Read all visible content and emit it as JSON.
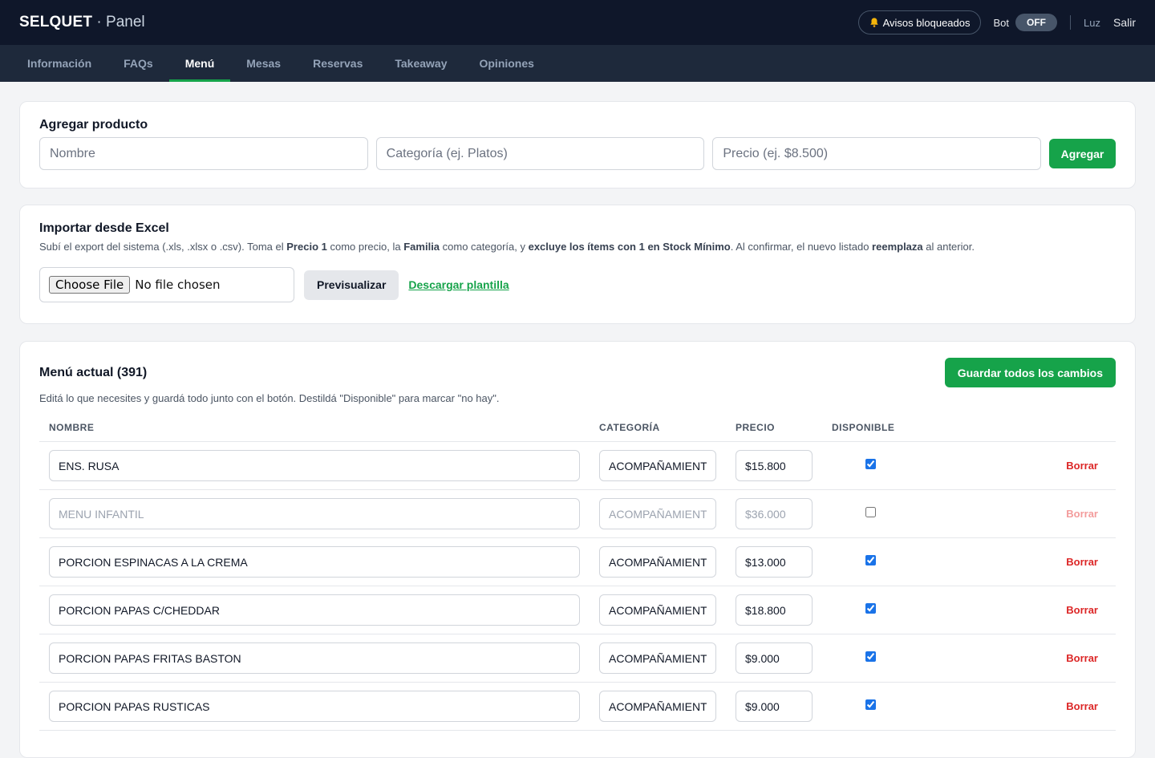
{
  "header": {
    "brand": "SELQUET",
    "separator": "·",
    "subtitle": "Panel",
    "alerts_label": "Avisos bloqueados",
    "bot_label": "Bot",
    "bot_state": "OFF",
    "user": "Luz",
    "logout": "Salir"
  },
  "tabs": [
    {
      "label": "Información",
      "active": false
    },
    {
      "label": "FAQs",
      "active": false
    },
    {
      "label": "Menú",
      "active": true
    },
    {
      "label": "Mesas",
      "active": false
    },
    {
      "label": "Reservas",
      "active": false
    },
    {
      "label": "Takeaway",
      "active": false
    },
    {
      "label": "Opiniones",
      "active": false
    }
  ],
  "add_product": {
    "title": "Agregar producto",
    "name_placeholder": "Nombre",
    "category_placeholder": "Categoría (ej. Platos)",
    "price_placeholder": "Precio (ej. $8.500)",
    "button": "Agregar"
  },
  "import": {
    "title": "Importar desde Excel",
    "desc_1": "Subí el export del sistema (.xls, .xlsx o .csv). Toma el ",
    "desc_b1": "Precio 1",
    "desc_2": " como precio, la ",
    "desc_b2": "Familia",
    "desc_3": " como categoría, y ",
    "desc_b3": "excluye los ítems con 1 en Stock Mínimo",
    "desc_4": ". Al confirmar, el nuevo listado ",
    "desc_b4": "reemplaza",
    "desc_5": " al anterior.",
    "file_button": "Choose File",
    "file_status": "No file chosen",
    "preview_button": "Previsualizar",
    "template_link": "Descargar plantilla"
  },
  "menu": {
    "title": "Menú actual (391)",
    "save_button": "Guardar todos los cambios",
    "desc": "Editá lo que necesites y guardá todo junto con el botón. Destildá \"Disponible\" para marcar \"no hay\".",
    "columns": {
      "name": "NOMBRE",
      "category": "CATEGORÍA",
      "price": "PRECIO",
      "available": "DISPONIBLE"
    },
    "delete_label": "Borrar",
    "rows": [
      {
        "name": "ENS. RUSA",
        "category": "ACOMPAÑAMIENTOS",
        "price": "$15.800",
        "available": true
      },
      {
        "name": "MENU INFANTIL",
        "category": "ACOMPAÑAMIENTOS",
        "price": "$36.000",
        "available": false
      },
      {
        "name": "PORCION ESPINACAS A LA CREMA",
        "category": "ACOMPAÑAMIENTOS",
        "price": "$13.000",
        "available": true
      },
      {
        "name": "PORCION PAPAS C/CHEDDAR",
        "category": "ACOMPAÑAMIENTOS",
        "price": "$18.800",
        "available": true
      },
      {
        "name": "PORCION PAPAS FRITAS BASTON",
        "category": "ACOMPAÑAMIENTOS",
        "price": "$9.000",
        "available": true
      },
      {
        "name": "PORCION PAPAS RUSTICAS",
        "category": "ACOMPAÑAMIENTOS",
        "price": "$9.000",
        "available": true
      }
    ]
  },
  "colors": {
    "accent": "#16a34a",
    "topbar": "#0f172a",
    "tabbar": "#1e293b",
    "danger": "#dc2626"
  },
  "icons": {
    "alerts": "bell-icon"
  }
}
